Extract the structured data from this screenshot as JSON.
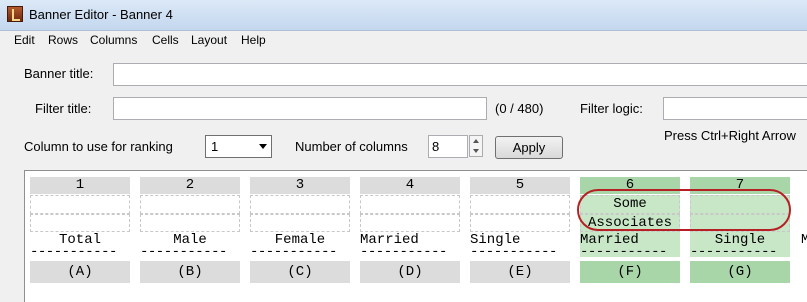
{
  "window": {
    "title": "Banner Editor - Banner 4"
  },
  "menu": [
    "Edit",
    "Rows",
    "Columns",
    "Cells",
    "Layout",
    "Help"
  ],
  "form": {
    "banner_title_label": "Banner title:",
    "banner_title_value": "",
    "filter_title_label": "Filter title:",
    "filter_title_value": "",
    "char_count": "(0 / 480)",
    "filter_logic_label": "Filter logic:",
    "hint": "Press Ctrl+Right Arrow",
    "ranking_label": "Column to use for ranking",
    "ranking_value": "1",
    "num_columns_label": "Number of columns",
    "num_columns_value": "8",
    "apply_label": "Apply"
  },
  "columns": [
    {
      "num": "1",
      "line1": "",
      "line2": "",
      "name": "Total",
      "dash": "-----------",
      "letter": "(A)",
      "highlight": false
    },
    {
      "num": "2",
      "line1": "",
      "line2": "",
      "name": "Male",
      "dash": "-----------",
      "letter": "(B)",
      "highlight": false
    },
    {
      "num": "3",
      "line1": "",
      "line2": "",
      "name": "Female",
      "dash": "-----------",
      "letter": "(C)",
      "highlight": false
    },
    {
      "num": "4",
      "line1": "",
      "line2": "",
      "name": "Married",
      "dash": "-----------",
      "letter": "(D)",
      "highlight": false
    },
    {
      "num": "5",
      "line1": "",
      "line2": "",
      "name": "Single",
      "dash": "-----------",
      "letter": "(E)",
      "highlight": false
    },
    {
      "num": "6",
      "line1": "Some College or",
      "line2": "Associates Degree",
      "name": "Married",
      "dash": "-----------",
      "letter": "(F)",
      "highlight": true
    },
    {
      "num": "7",
      "line1": "",
      "line2": "",
      "name": "Single",
      "dash": "-----------",
      "letter": "(G)",
      "highlight": true
    }
  ],
  "partial_column": {
    "name_fragment": "M"
  }
}
